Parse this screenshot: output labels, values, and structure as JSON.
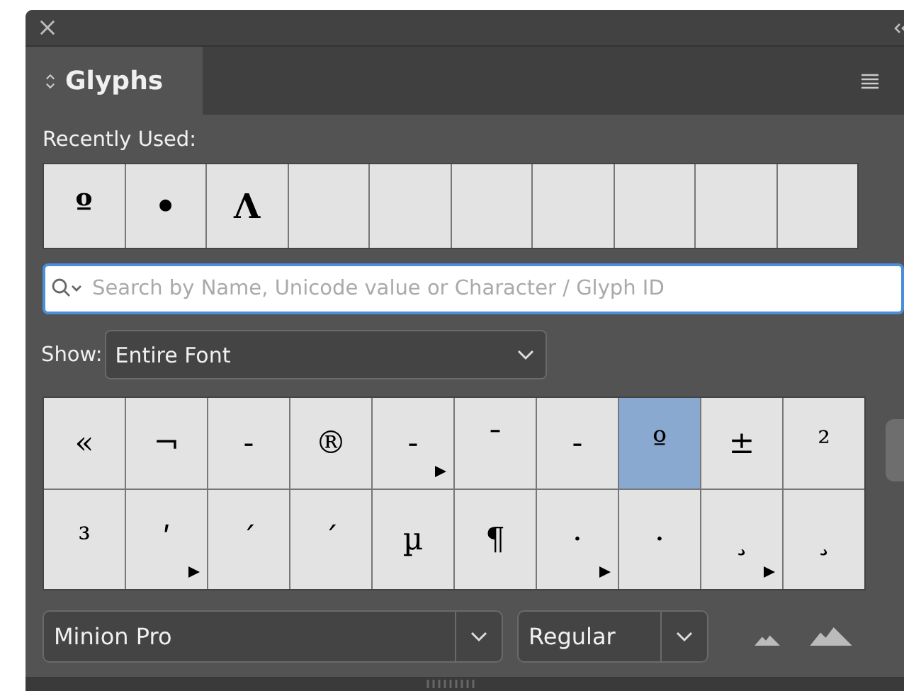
{
  "panel": {
    "tab": {
      "label": "Glyphs",
      "selected": true
    }
  },
  "recently_used": {
    "label": "Recently Used:",
    "glyphs": [
      "º",
      "•",
      "Ʌ"
    ]
  },
  "search": {
    "placeholder": "Search by Name, Unicode value or Character / Glyph ID"
  },
  "show": {
    "label": "Show:",
    "value": "Entire Font"
  },
  "glyphs": [
    {
      "char": "«",
      "alternates": false,
      "selected": false
    },
    {
      "char": "¬",
      "alternates": false,
      "selected": false
    },
    {
      "char": "-",
      "alternates": false,
      "selected": false
    },
    {
      "char": "®",
      "alternates": false,
      "selected": false
    },
    {
      "char": "‐",
      "alternates": true,
      "selected": false
    },
    {
      "char": "¯",
      "alternates": false,
      "selected": false
    },
    {
      "char": "‐",
      "alternates": false,
      "selected": false
    },
    {
      "char": "º",
      "alternates": false,
      "selected": true
    },
    {
      "char": "±",
      "alternates": false,
      "selected": false
    },
    {
      "char": "²",
      "alternates": false,
      "selected": false
    },
    {
      "char": "³",
      "alternates": false,
      "selected": false
    },
    {
      "char": "ʹ",
      "alternates": true,
      "selected": false
    },
    {
      "char": "ˊ",
      "alternates": false,
      "selected": false
    },
    {
      "char": "´",
      "alternates": false,
      "selected": false
    },
    {
      "char": "µ",
      "alternates": false,
      "selected": false
    },
    {
      "char": "¶",
      "alternates": false,
      "selected": false
    },
    {
      "char": "·",
      "alternates": true,
      "selected": false
    },
    {
      "char": "·",
      "alternates": false,
      "selected": false
    },
    {
      "char": "¸",
      "alternates": true,
      "selected": false
    },
    {
      "char": "¸",
      "alternates": false,
      "selected": false
    }
  ],
  "font": {
    "family": "Minion Pro",
    "style": "Regular"
  }
}
